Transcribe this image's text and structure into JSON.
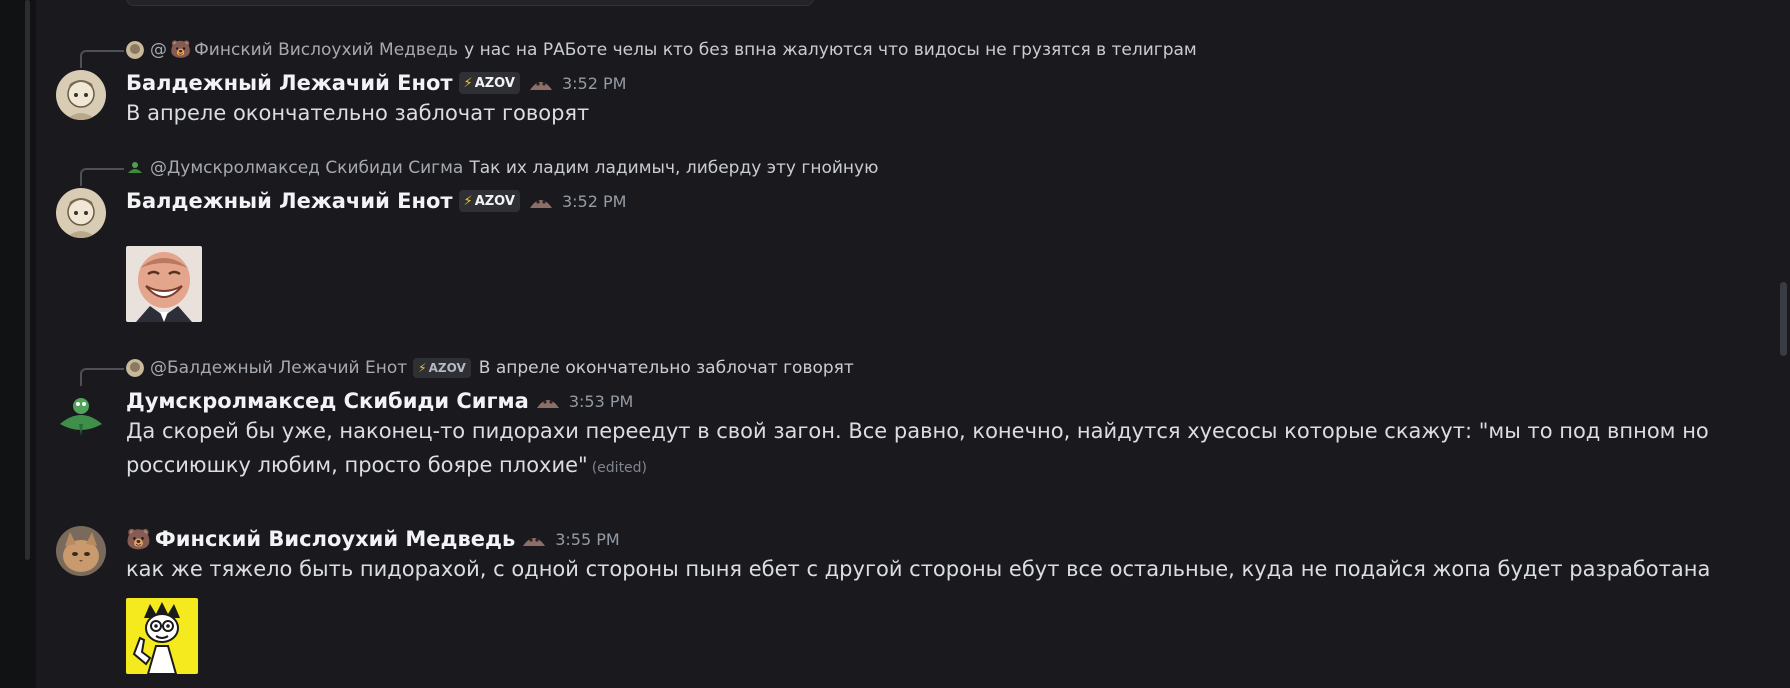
{
  "colors": {
    "background": "#1a1a1e",
    "username": "#f2f3f5",
    "reply_name": "#a6a9b0",
    "timestamp": "#949ba4",
    "tag_bolt": "#f0c419"
  },
  "messages": [
    {
      "reply": {
        "mention": "@",
        "name": "Финский Вислоухий Медведь",
        "text": "у нас на РАБоте челы кто без впна жалуются что видосы не грузятся в телиграм"
      },
      "author": "Балдежный Лежачий Енот",
      "tag": "AZOV",
      "time": "3:52 PM",
      "text": "В апреле окончательно заблочат говорят"
    },
    {
      "reply": {
        "name": "@Думскролмаксед Скибиди Сигма",
        "text": "Так их ладим ладимыч, либерду эту гнойную"
      },
      "author": "Балдежный Лежачий Енот",
      "tag": "AZOV",
      "time": "3:52 PM",
      "sticker": "laughing-face-sticker"
    },
    {
      "reply": {
        "name": "@Балдежный Лежачий Енот",
        "tag": "AZOV",
        "text": "В апреле окончательно заблочат говорят"
      },
      "author": "Думскролмаксед Скибиди Сигма",
      "time": "3:53 PM",
      "text_line1": "Да скорей бы уже, наконец-то пидорахи переедут в свой загон. Все равно, конечно, найдутся хуесосы которые скажут: \"мы то под впном но",
      "text_line2": "россиюшку любим, просто бояре плохие\"",
      "edited": "(edited)"
    },
    {
      "author": "Финский Вислоухий Медведь",
      "time": "3:55 PM",
      "text": "как же тяжело быть пидорахой, с одной стороны пыня ебет с другой стороны ебут все остальные, куда не подайся жопа будет разработана",
      "sticker": "cartoon-pointing-man-sticker"
    }
  ],
  "icons": {
    "bolt": "⚡",
    "bear": "🐻"
  }
}
